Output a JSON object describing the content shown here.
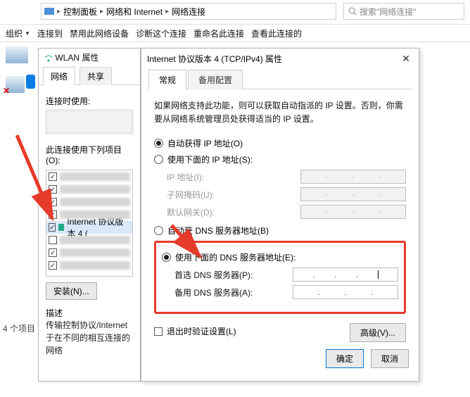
{
  "breadcrumb": {
    "p1": "控制面板",
    "p2": "网络和 Internet",
    "p3": "网络连接"
  },
  "search": {
    "placeholder": "搜索\"网络连接\""
  },
  "toolbar": {
    "org": "组织",
    "connect": "连接到",
    "disable": "禁用此网络设备",
    "diagnose": "诊断这个连接",
    "rename": "重命名此连接",
    "viewstatus": "查看此连接的"
  },
  "count_label": "4 个项目",
  "wlan": {
    "title": "WLAN 属性",
    "tab_net": "网络",
    "tab_share": "共享",
    "connect_using": "连接时使用:",
    "uses_items": "此连接使用下列项目(O):",
    "selected_item": "Internet 协议版本 4 (",
    "install": "安装(N)...",
    "desc_title": "描述",
    "desc": "传输控制协议/Internet 于在不同的相互连接的网络"
  },
  "ipv4": {
    "title": "Internet 协议版本 4 (TCP/IPv4) 属性",
    "tab_general": "常规",
    "tab_alt": "备用配置",
    "para": "如果网络支持此功能，则可以获取自动指派的 IP 设置。否则，你需要从网络系统管理员处获得适当的 IP 设置。",
    "r1": "自动获得 IP 地址(O)",
    "r2": "使用下面的 IP 地址(S):",
    "ip_lbl": "IP 地址(I):",
    "mask_lbl": "子网掩码(U):",
    "gw_lbl": "默认网关(D):",
    "r3": "自动获",
    "r3b": " DNS 服务器地址(B)",
    "r4": "使用下面的 DNS 服务器地址(E):",
    "dns1_lbl": "首选 DNS 服务器(P):",
    "dns2_lbl": "备用 DNS 服务器(A):",
    "validate": "退出时验证设置(L)",
    "advanced": "高级(V)...",
    "ok": "确定",
    "cancel": "取消"
  }
}
